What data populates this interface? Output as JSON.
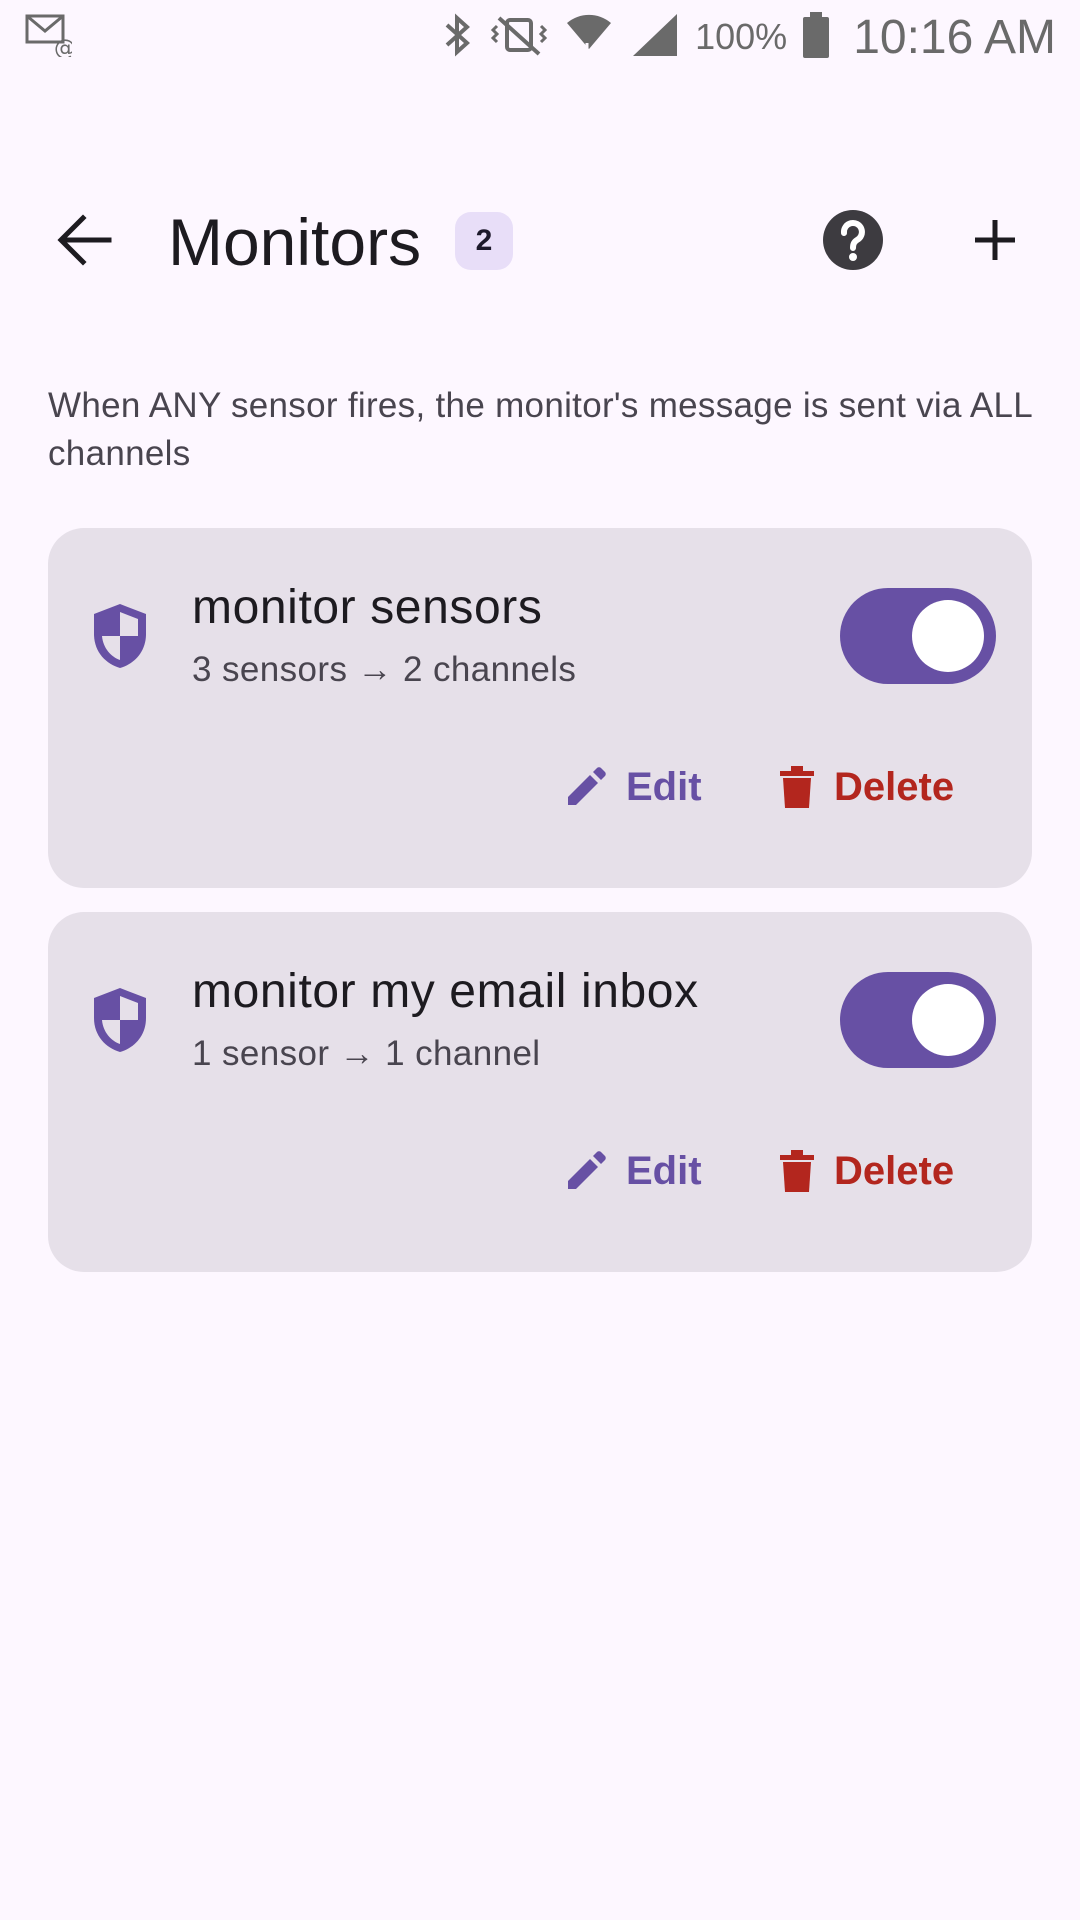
{
  "status_bar": {
    "battery": "100%",
    "time": "10:16 AM",
    "icons": [
      "screencast-email-icon",
      "bluetooth-icon",
      "vibrate-off-icon",
      "wifi-icon",
      "cell-signal-icon",
      "battery-icon"
    ]
  },
  "header": {
    "title": "Monitors",
    "count": "2"
  },
  "info_text": "When ANY sensor fires, the monitor's message is sent via ALL channels",
  "monitors": [
    {
      "name": "monitor sensors",
      "summary": "3 sensors → 2 channels",
      "enabled": true,
      "edit_label": "Edit",
      "delete_label": "Delete"
    },
    {
      "name": "monitor my email inbox",
      "summary": "1 sensor → 1 channel",
      "enabled": true,
      "edit_label": "Edit",
      "delete_label": "Delete"
    }
  ],
  "colors": {
    "background": "#fdf7ff",
    "card": "#e6e0e9",
    "primary": "#6750a4",
    "error": "#b3261e",
    "badge": "#e8def8"
  }
}
